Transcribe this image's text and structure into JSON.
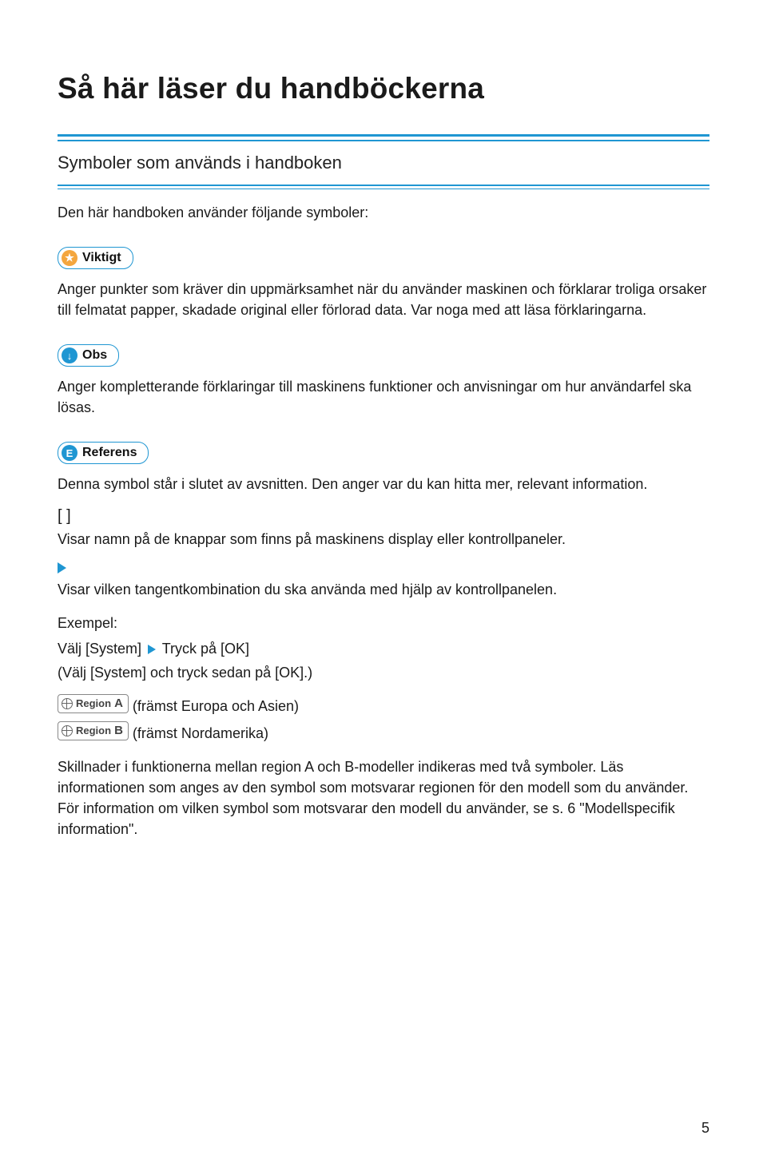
{
  "title": "Så här läser du handböckerna",
  "subtitle": "Symboler som används i handboken",
  "intro": "Den här handboken använder följande symboler:",
  "labels": {
    "viktigt": "Viktigt",
    "obs": "Obs",
    "referens": "Referens"
  },
  "viktigt_text": "Anger punkter som kräver din uppmärksamhet när du använder maskinen och förklarar troliga orsaker till felmatat papper, skadade original eller förlorad data. Var noga med att läsa förklaringarna.",
  "obs_text": "Anger kompletterande förklaringar till maskinens funktioner och anvisningar om hur användarfel ska lösas.",
  "referens_text": "Denna symbol står i slutet av avsnitten. Den anger var du kan hitta mer, relevant information.",
  "brackets_symbol": "[ ]",
  "brackets_text": "Visar namn på de knappar som finns på maskinens display eller kontrollpaneler.",
  "triangle_text": "Visar vilken tangentkombination du ska använda med hjälp av kontrollpanelen.",
  "example": {
    "header": "Exempel:",
    "line1_a": "Välj [System] ",
    "line1_b": " Tryck på [OK]",
    "line2": "(Välj [System] och tryck sedan på [OK].)"
  },
  "region": {
    "label": "Region",
    "a_letter": "A",
    "b_letter": "B",
    "a_text": " (främst Europa och Asien)",
    "b_text": " (främst Nordamerika)"
  },
  "region_para": "Skillnader i funktionerna mellan region A och B-modeller indikeras med två symboler. Läs informationen som anges av den symbol som motsvarar regionen för den modell som du använder. För information om vilken symbol som motsvarar den modell du använder, se s. 6 \"Modellspecifik information\".",
  "page_number": "5"
}
